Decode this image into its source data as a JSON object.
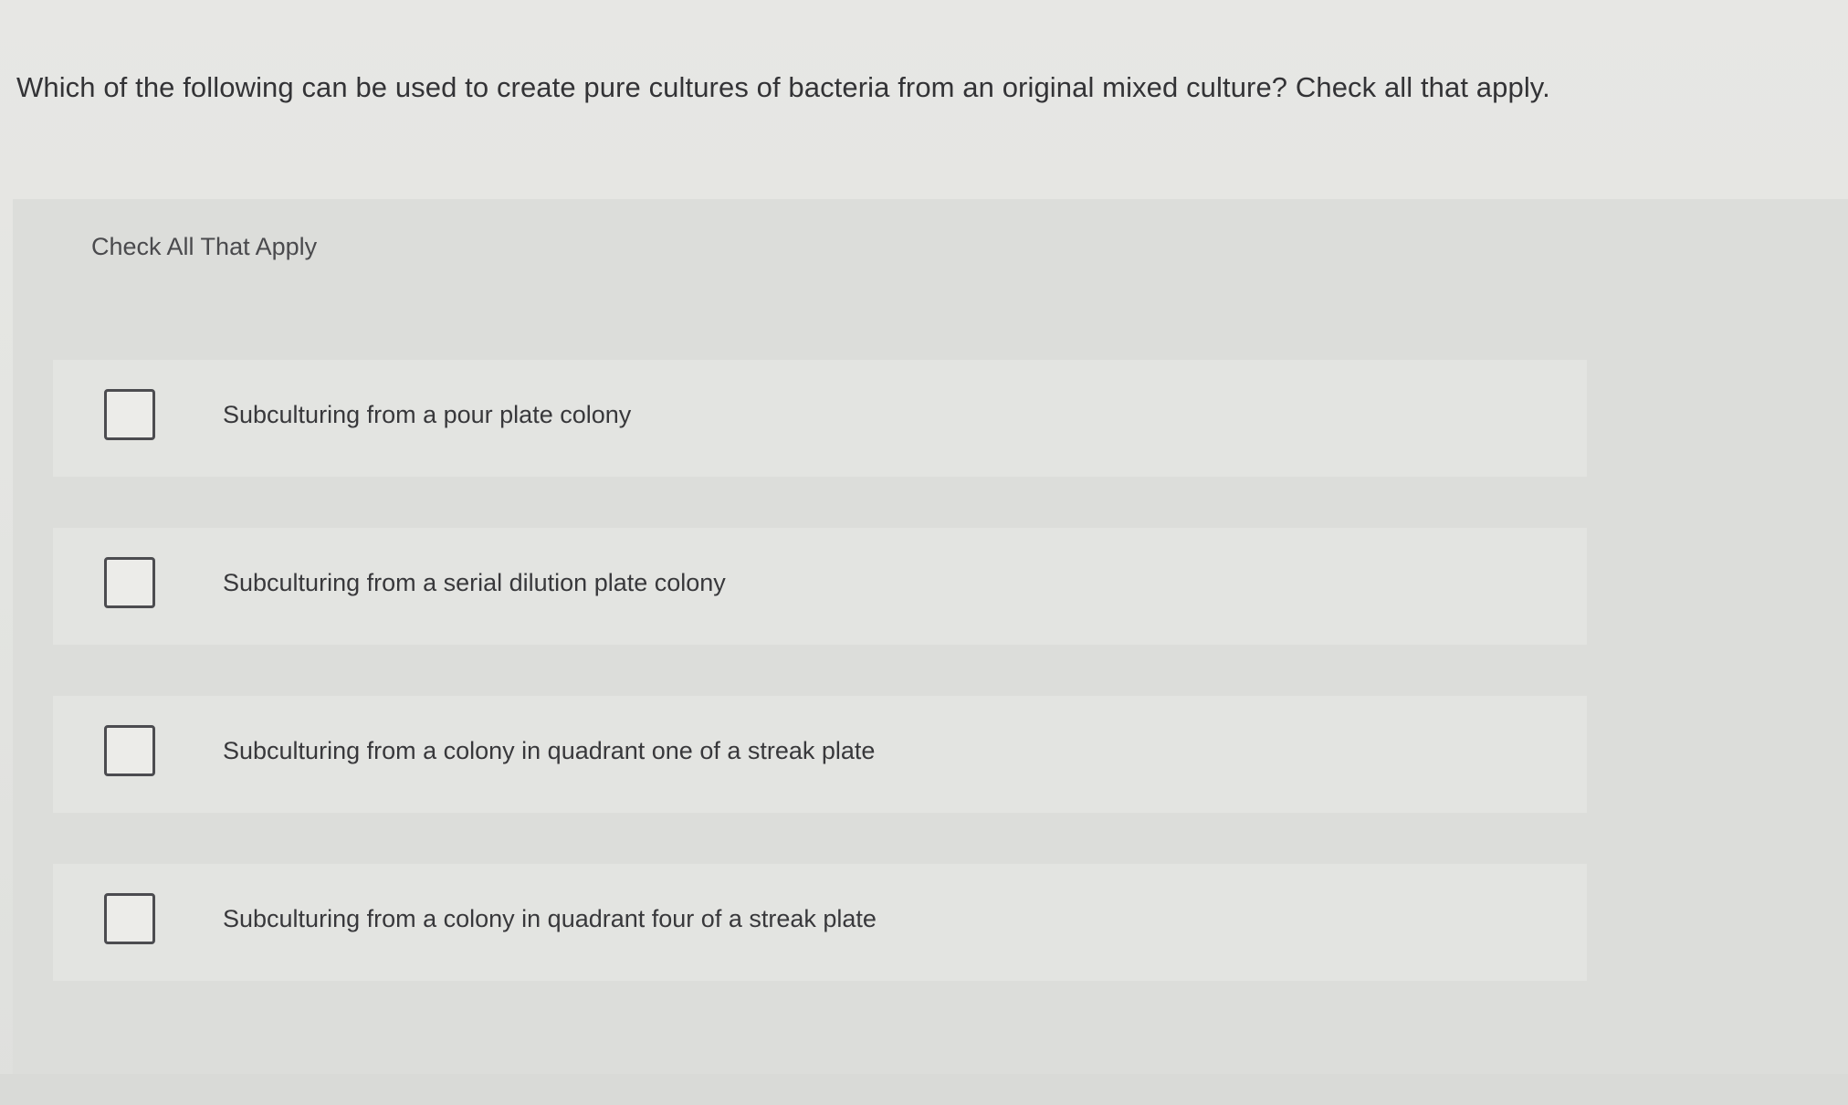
{
  "question": {
    "text": "Which of the following can be used to create pure cultures of bacteria from an original mixed culture? Check all that apply."
  },
  "panel": {
    "header": "Check All That Apply",
    "options": [
      {
        "label": "Subculturing from a pour plate colony",
        "checked": false
      },
      {
        "label": "Subculturing from a serial dilution plate colony",
        "checked": false
      },
      {
        "label": "Subculturing from a colony in quadrant one of a streak plate",
        "checked": false
      },
      {
        "label": "Subculturing from a colony in quadrant four of a streak plate",
        "checked": false
      }
    ]
  }
}
